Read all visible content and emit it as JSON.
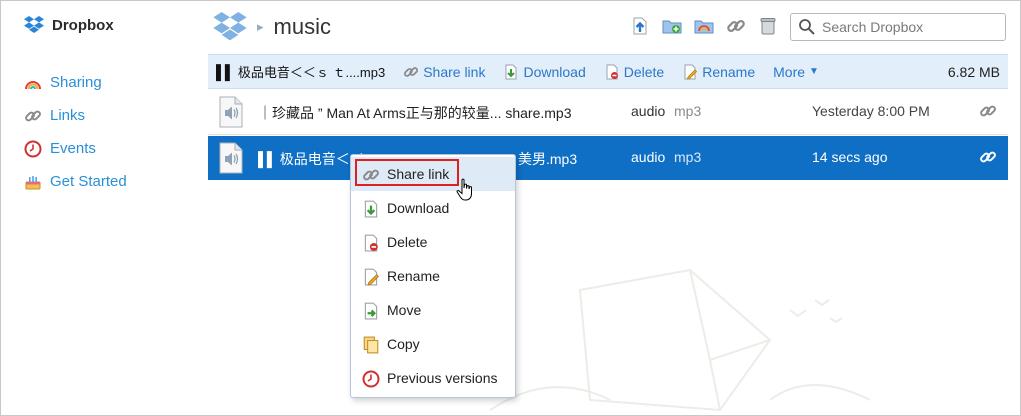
{
  "sidebar": {
    "brand": "Dropbox",
    "items": [
      {
        "label": "Sharing",
        "icon": "rainbow-icon"
      },
      {
        "label": "Links",
        "icon": "link-icon"
      },
      {
        "label": "Events",
        "icon": "clock-icon"
      },
      {
        "label": "Get Started",
        "icon": "cake-icon"
      }
    ]
  },
  "header": {
    "folder_title": "music",
    "search_placeholder": "Search Dropbox",
    "tool_icons": [
      "upload-icon",
      "new-folder-icon",
      "shared-folder-icon",
      "link-icon",
      "trash-icon"
    ]
  },
  "actionbar": {
    "selected_name": "极品电音＜＜ｓ ｔ....mp3",
    "actions": {
      "share": "Share link",
      "download": "Download",
      "delete": "Delete",
      "rename": "Rename",
      "more": "More"
    },
    "size": "6.82 MB"
  },
  "files": [
    {
      "name": "｜珍藏品 ” Man At Arms正与那的较量... share.mp3",
      "type": "audio",
      "ext": "mp3",
      "modified": "Yesterday 8:00 PM"
    },
    {
      "name": "极品电音＜＜",
      "name_tail": "美男.mp3",
      "type": "audio",
      "ext": "mp3",
      "modified": "14 secs ago"
    }
  ],
  "context_menu": {
    "items": [
      {
        "label": "Share link",
        "icon": "link-icon"
      },
      {
        "label": "Download",
        "icon": "download-icon"
      },
      {
        "label": "Delete",
        "icon": "delete-icon"
      },
      {
        "label": "Rename",
        "icon": "rename-icon"
      },
      {
        "label": "Move",
        "icon": "move-icon"
      },
      {
        "label": "Copy",
        "icon": "copy-icon"
      },
      {
        "label": "Previous versions",
        "icon": "previous-versions-icon"
      }
    ]
  },
  "colors": {
    "accent": "#2a78c8",
    "selected_row": "#0e6fc4",
    "actionbar_bg": "#e3eefb",
    "highlight_box": "#e02020"
  }
}
